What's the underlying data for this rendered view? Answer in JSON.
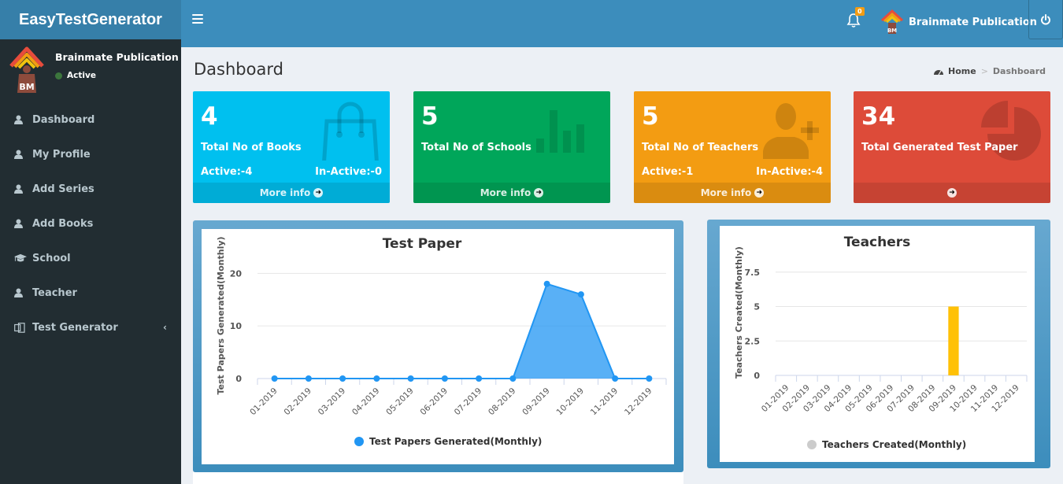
{
  "app": {
    "title": "EasyTestGenerator"
  },
  "header": {
    "notifications_count": "0",
    "user_name": "Brainmate Publication",
    "icons": {
      "menu": "hamburger-icon",
      "bell": "bell-icon",
      "power": "power-icon"
    }
  },
  "sidebar": {
    "user": {
      "name": "Brainmate Publication",
      "status": "Active",
      "status_color": "#3c763d"
    },
    "items": [
      {
        "label": "Dashboard",
        "icon": "user-icon"
      },
      {
        "label": "My Profile",
        "icon": "user-icon"
      },
      {
        "label": "Add Series",
        "icon": "user-icon"
      },
      {
        "label": "Add Books",
        "icon": "user-icon"
      },
      {
        "label": "School",
        "icon": "graduation-cap-icon"
      },
      {
        "label": "Teacher",
        "icon": "user-icon"
      },
      {
        "label": "Test Generator",
        "icon": "copy-icon",
        "has_submenu": true
      }
    ]
  },
  "page": {
    "title": "Dashboard",
    "breadcrumb": {
      "home": "Home",
      "separator": ">",
      "current": "Dashboard"
    }
  },
  "stats": [
    {
      "value": "4",
      "label": "Total No of Books",
      "active": "Active:-4",
      "inactive": "In-Active:-0",
      "footer": "More info",
      "color": "#00c0ef",
      "icon": "shopping-bag-icon"
    },
    {
      "value": "5",
      "label": "Total No of Schools",
      "active": "",
      "inactive": "",
      "footer": "More info",
      "color": "#00a65a",
      "icon": "bar-chart-icon"
    },
    {
      "value": "5",
      "label": "Total No of Teachers",
      "active": "Active:-1",
      "inactive": "In-Active:-4",
      "footer": "More info",
      "color": "#f39c12",
      "icon": "user-plus-icon"
    },
    {
      "value": "34",
      "label": "Total Generated Test Paper",
      "active": "",
      "inactive": "",
      "footer": "",
      "color": "#dd4b39",
      "icon": "pie-chart-icon"
    }
  ],
  "chart_data": [
    {
      "type": "area",
      "title": "Test Paper",
      "xlabel": "",
      "ylabel": "Test Papers Generated(Monthly)",
      "categories": [
        "01-2019",
        "02-2019",
        "03-2019",
        "04-2019",
        "05-2019",
        "06-2019",
        "07-2019",
        "08-2019",
        "09-2019",
        "10-2019",
        "11-2019",
        "12-2019"
      ],
      "series": [
        {
          "name": "Test Papers Generated(Monthly)",
          "values": [
            0,
            0,
            0,
            0,
            0,
            0,
            0,
            0,
            18,
            16,
            0,
            0
          ],
          "color": "#2196f3"
        }
      ],
      "yticks": [
        "0",
        "10",
        "20"
      ],
      "ylim": [
        0,
        22
      ],
      "grid": true,
      "legend": "bottom"
    },
    {
      "type": "bar",
      "title": "Teachers",
      "xlabel": "",
      "ylabel": "Teachers Created(Monthly)",
      "categories": [
        "01-2019",
        "02-2019",
        "03-2019",
        "04-2019",
        "05-2019",
        "06-2019",
        "07-2019",
        "08-2019",
        "09-2019",
        "10-2019",
        "11-2019",
        "12-2019"
      ],
      "series": [
        {
          "name": "Teachers Created(Monthly)",
          "values": [
            0,
            0,
            0,
            0,
            0,
            0,
            0,
            0,
            5,
            0,
            0,
            0
          ],
          "color": "#ffc107",
          "legend_color": "#cccccc"
        }
      ],
      "yticks": [
        "0",
        "2.5",
        "5",
        "7.5"
      ],
      "ylim": [
        0,
        8
      ],
      "grid": true,
      "legend": "bottom"
    }
  ]
}
